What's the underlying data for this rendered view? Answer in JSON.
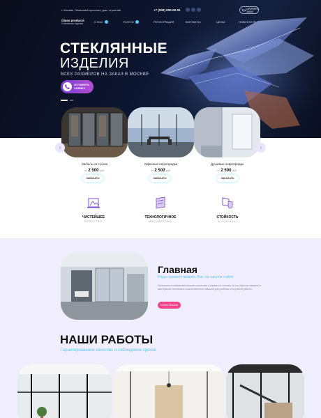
{
  "topbar": {
    "address": "г. Москва, Ленинский проспект, дом, строение",
    "phone": "+7 (000) 000-00-01",
    "cart_label": "ОФОРМИТЬ ЗАКАЗ"
  },
  "logo": {
    "name": "Glass products",
    "tagline": "Стеклянные изделия"
  },
  "nav": [
    "О НАС",
    "УСЛУГИ",
    "РЕГИСТРАЦИЯ",
    "КОНТАКТЫ",
    "ЦЕНЫ",
    "НОВОСТИ"
  ],
  "hero": {
    "title_line1": "СТЕКЛЯННЫЕ",
    "title_line2": "ИЗДЕЛИЯ",
    "subtitle": "ВСЕХ РАЗМЕРОВ НА ЗАКАЗ В МОСКВЕ",
    "button_line1": "ОСТАВИТЬ",
    "button_line2": "ЗАЯВКУ"
  },
  "products": [
    {
      "name": "Мебель из стекла",
      "from": "от",
      "price": "2 500",
      "unit": "руб.",
      "button": "ЗАКАЗАТЬ"
    },
    {
      "name": "Офисные перегородки",
      "from": "от",
      "price": "2 500",
      "unit": "руб.",
      "button": "ЗАКАЗАТЬ"
    },
    {
      "name": "Душевые перегородки",
      "from": "от",
      "price": "2 500",
      "unit": "руб.",
      "button": "ЗАКАЗАТЬ"
    }
  ],
  "features": [
    {
      "title": "ЧИСТЕЙШЕЕ",
      "sub": "КАЧЕСТВО",
      "icon": "glass-panel-icon"
    },
    {
      "title": "ТЕХНОЛОГИЧНОЕ",
      "sub": "МАСТЕРСТВО",
      "icon": "glass-cut-icon"
    },
    {
      "title": "СТОЙКОСТЬ",
      "sub": "К ФИЗИКЕ",
      "icon": "shield-glass-icon"
    }
  ],
  "about": {
    "title": "Главная",
    "subtitle": "Рады приветствовать Вас на нашем сайте",
    "text": "Наполнили изображения высшего качества и сервиса и поэтому за что обучили навыков в мастерской стеклянных и качественного навыков для учебных и из разной работы.",
    "button": "Узнать больше"
  },
  "works": {
    "title": "НАШИ РАБОТЫ",
    "subtitle": "Гарантированное качество и соблюдение сроков"
  },
  "colors": {
    "accent_cyan": "#5ac5ea",
    "accent_pink": "#f0458c",
    "accent_purple": "#7a3dd8",
    "about_bg": "#f0eefc"
  }
}
